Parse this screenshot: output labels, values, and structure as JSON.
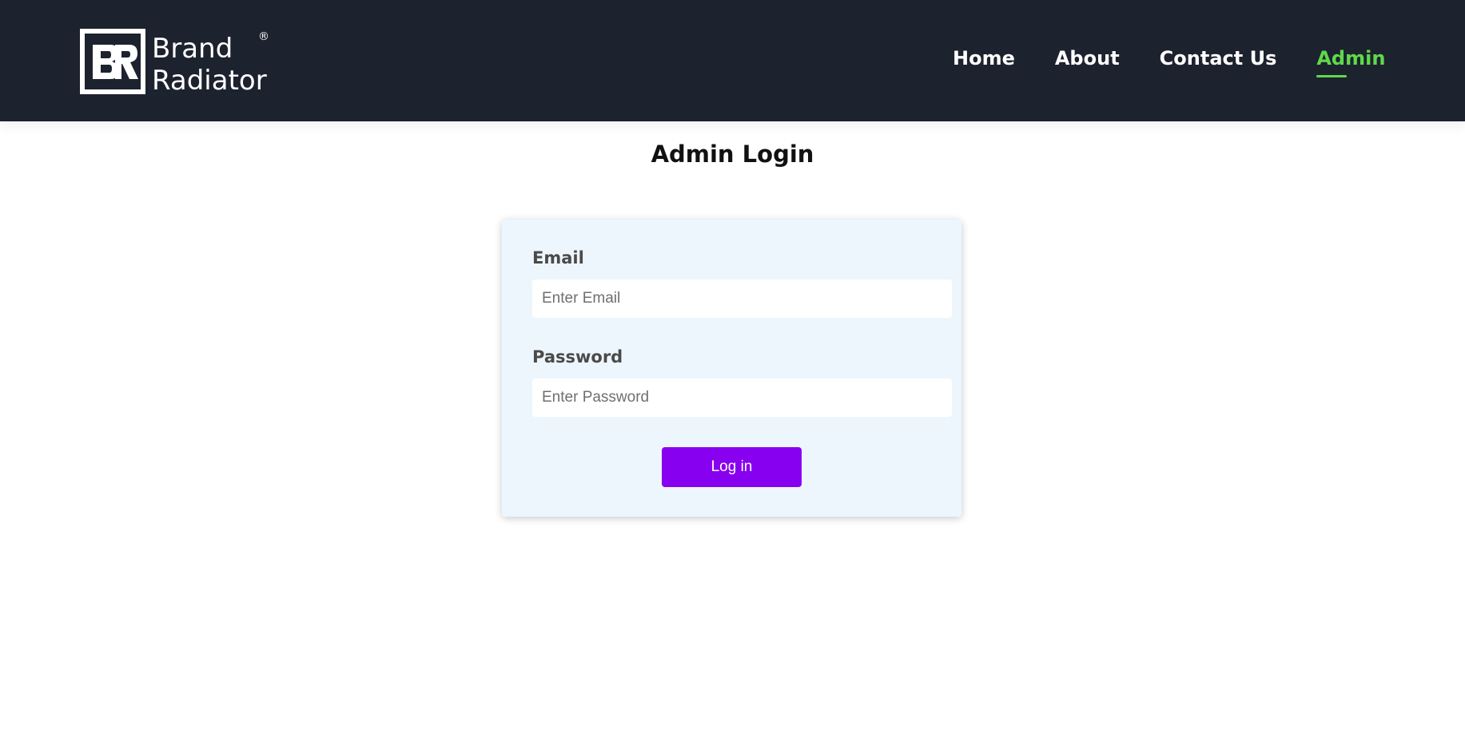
{
  "brand": {
    "logo_icon": "br-monogram-logo",
    "name_line1": "Brand",
    "name_line2": "Radiator",
    "registered_mark": "®"
  },
  "nav": {
    "items": [
      {
        "label": "Home",
        "active": false
      },
      {
        "label": "About",
        "active": false
      },
      {
        "label": "Contact Us",
        "active": false
      },
      {
        "label": "Admin",
        "active": true
      }
    ]
  },
  "page": {
    "title": "Admin Login"
  },
  "form": {
    "email_label": "Email",
    "email_placeholder": "Enter Email",
    "email_value": "",
    "password_label": "Password",
    "password_placeholder": "Enter Password",
    "password_value": "",
    "submit_label": "Log in"
  },
  "colors": {
    "navbar_bg": "#1d222f",
    "active_link": "#5fd94a",
    "card_bg": "#eef6fd",
    "button_bg": "#8800f0"
  }
}
